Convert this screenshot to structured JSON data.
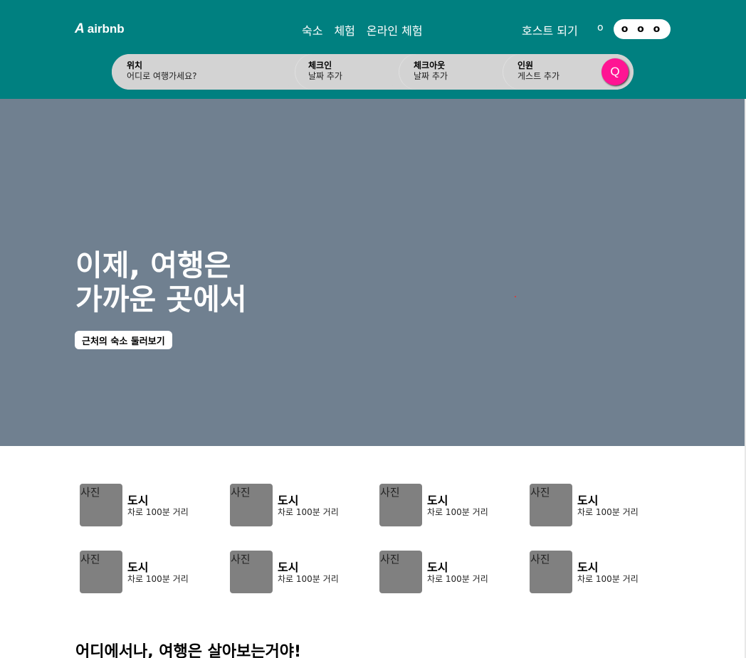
{
  "header": {
    "logo_mark": "A",
    "logo_text": "airbnb",
    "nav": [
      "숙소",
      "체험",
      "온라인 체험"
    ],
    "host_label": "호스트 되기",
    "globe_glyph": "o",
    "menu_glyph": "o o o",
    "bg_color": "#008080"
  },
  "search": {
    "location": {
      "label": "위치",
      "placeholder": "어디로 여행가세요?"
    },
    "checkin": {
      "label": "체크인",
      "placeholder": "날짜 추가"
    },
    "checkout": {
      "label": "체크아웃",
      "placeholder": "날짜 추가"
    },
    "guests": {
      "label": "인원",
      "placeholder": "게스트 추가"
    },
    "button_glyph": "Q",
    "button_color": "#ff1493"
  },
  "hero": {
    "title_line1": "이제, 여행은",
    "title_line2": "가까운 곳에서",
    "button_label": "근처의 숙소 둘러보기",
    "bg_color": "#708090"
  },
  "nearby": {
    "items": [
      {
        "photo": "사진",
        "city": "도시",
        "distance": "차로 100분 거리"
      },
      {
        "photo": "사진",
        "city": "도시",
        "distance": "차로 100분 거리"
      },
      {
        "photo": "사진",
        "city": "도시",
        "distance": "차로 100분 거리"
      },
      {
        "photo": "사진",
        "city": "도시",
        "distance": "차로 100분 거리"
      },
      {
        "photo": "사진",
        "city": "도시",
        "distance": "차로 100분 거리"
      },
      {
        "photo": "사진",
        "city": "도시",
        "distance": "차로 100분 거리"
      },
      {
        "photo": "사진",
        "city": "도시",
        "distance": "차로 100분 거리"
      },
      {
        "photo": "사진",
        "city": "도시",
        "distance": "차로 100분 거리"
      }
    ]
  },
  "section": {
    "title": "어디에서나, 여행은 살아보는거야!"
  }
}
